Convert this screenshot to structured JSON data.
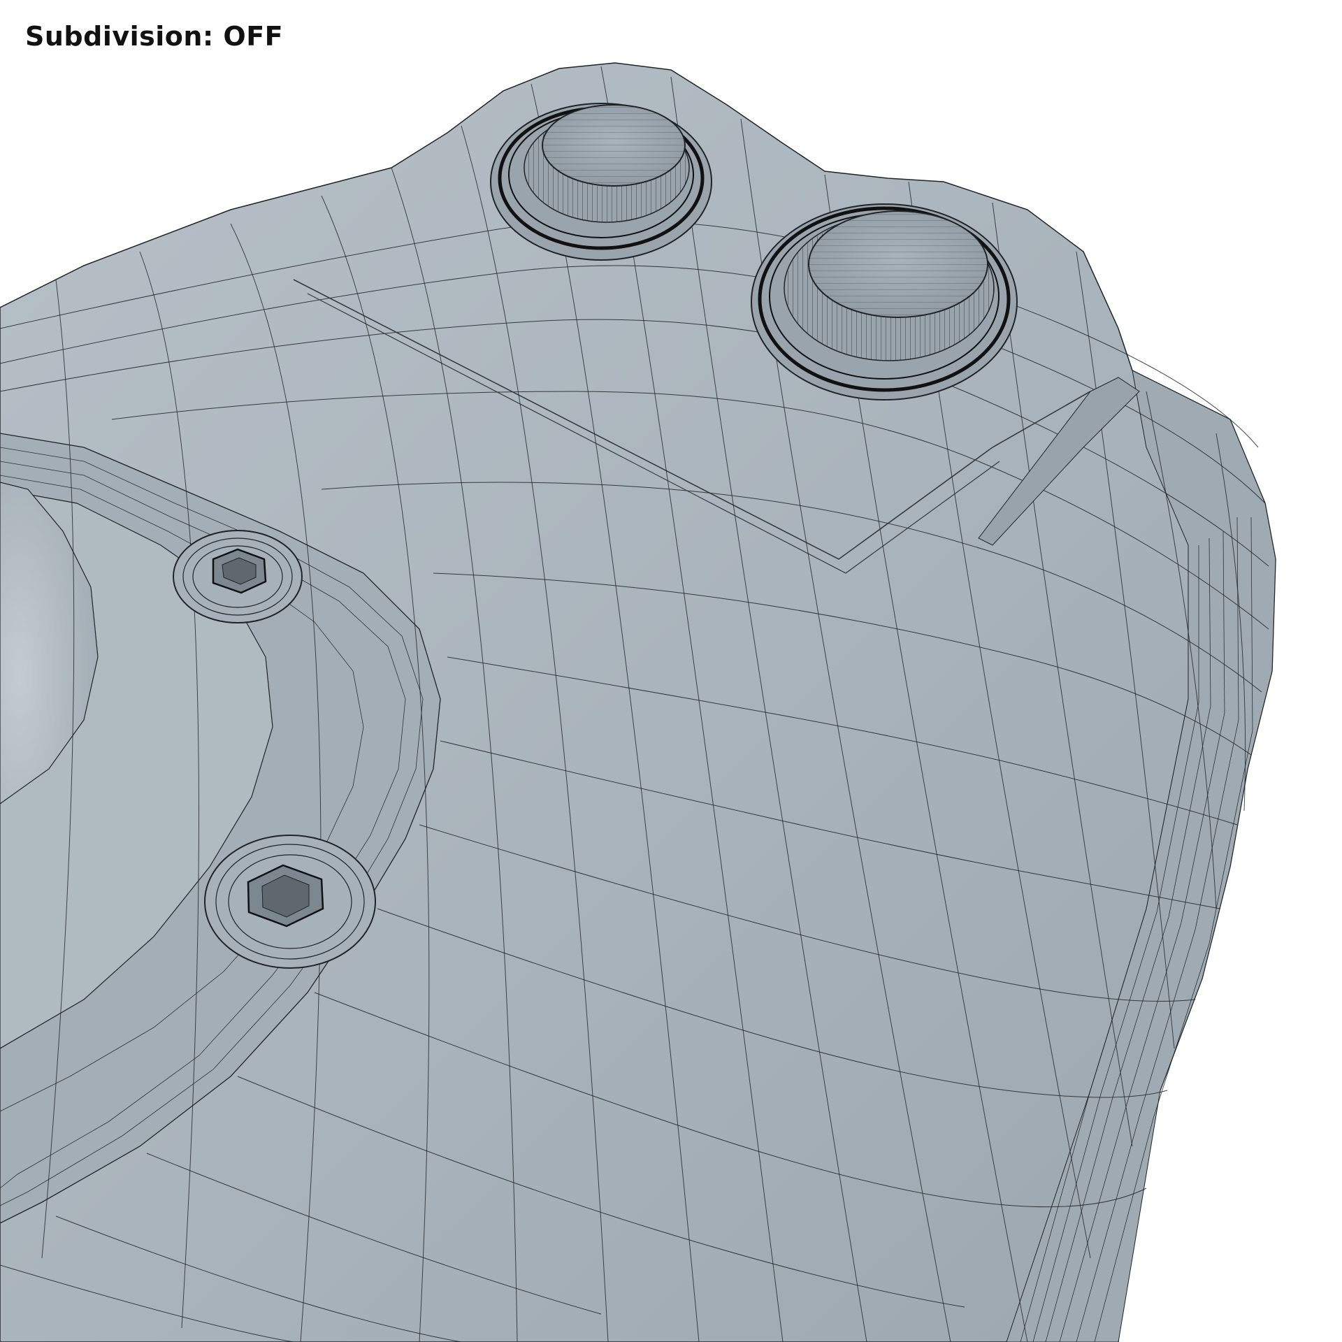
{
  "caption": {
    "label": "Subdivision",
    "value": "OFF"
  },
  "colors": {
    "background": "#ffffff",
    "surface": "#a8b2ba",
    "surface_light": "#bcc5cc",
    "surface_dark": "#8e99a2",
    "wire": "#1f2428"
  },
  "icons": [
    "mounting-bolt-icon",
    "hex-socket-screw-icon"
  ]
}
